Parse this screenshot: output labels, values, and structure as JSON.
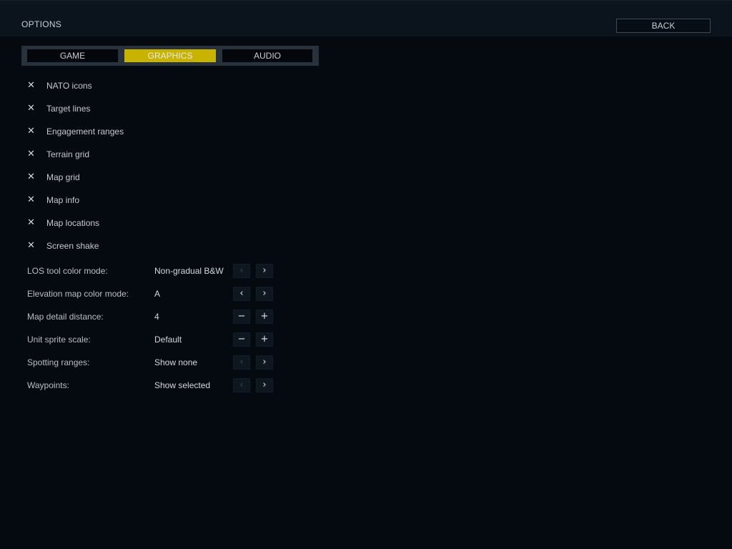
{
  "header": {
    "title": "OPTIONS",
    "back_label": "BACK"
  },
  "tabs": [
    {
      "label": "GAME",
      "active": false
    },
    {
      "label": "GRAPHICS",
      "active": true
    },
    {
      "label": "AUDIO",
      "active": false
    }
  ],
  "checkbox_mark": "✕",
  "checkboxes": [
    {
      "label": "NATO icons",
      "checked": true
    },
    {
      "label": "Target lines",
      "checked": true
    },
    {
      "label": "Engagement ranges",
      "checked": true
    },
    {
      "label": "Terrain grid",
      "checked": true
    },
    {
      "label": "Map grid",
      "checked": true
    },
    {
      "label": "Map info",
      "checked": true
    },
    {
      "label": "Map locations",
      "checked": true
    },
    {
      "label": "Screen shake",
      "checked": true
    }
  ],
  "controls": {
    "prev_glyph": "‹",
    "next_glyph": "›",
    "minus_glyph": "−",
    "plus_glyph": "+"
  },
  "options": [
    {
      "label": "LOS tool color mode:",
      "value": "Non-gradual B&W",
      "control": "arrows",
      "left_enabled": false,
      "right_enabled": true
    },
    {
      "label": "Elevation map color mode:",
      "value": "A",
      "control": "arrows",
      "left_enabled": true,
      "right_enabled": true
    },
    {
      "label": "Map detail distance:",
      "value": "4",
      "control": "stepper",
      "left_enabled": true,
      "right_enabled": true
    },
    {
      "label": "Unit sprite scale:",
      "value": "Default",
      "control": "stepper",
      "left_enabled": true,
      "right_enabled": true
    },
    {
      "label": "Spotting ranges:",
      "value": "Show none",
      "control": "arrows",
      "left_enabled": false,
      "right_enabled": true
    },
    {
      "label": "Waypoints:",
      "value": "Show selected",
      "control": "arrows",
      "left_enabled": false,
      "right_enabled": true
    }
  ],
  "colors": {
    "accent": "#c7b300",
    "background": "#040a10",
    "header": "#0b141d"
  }
}
